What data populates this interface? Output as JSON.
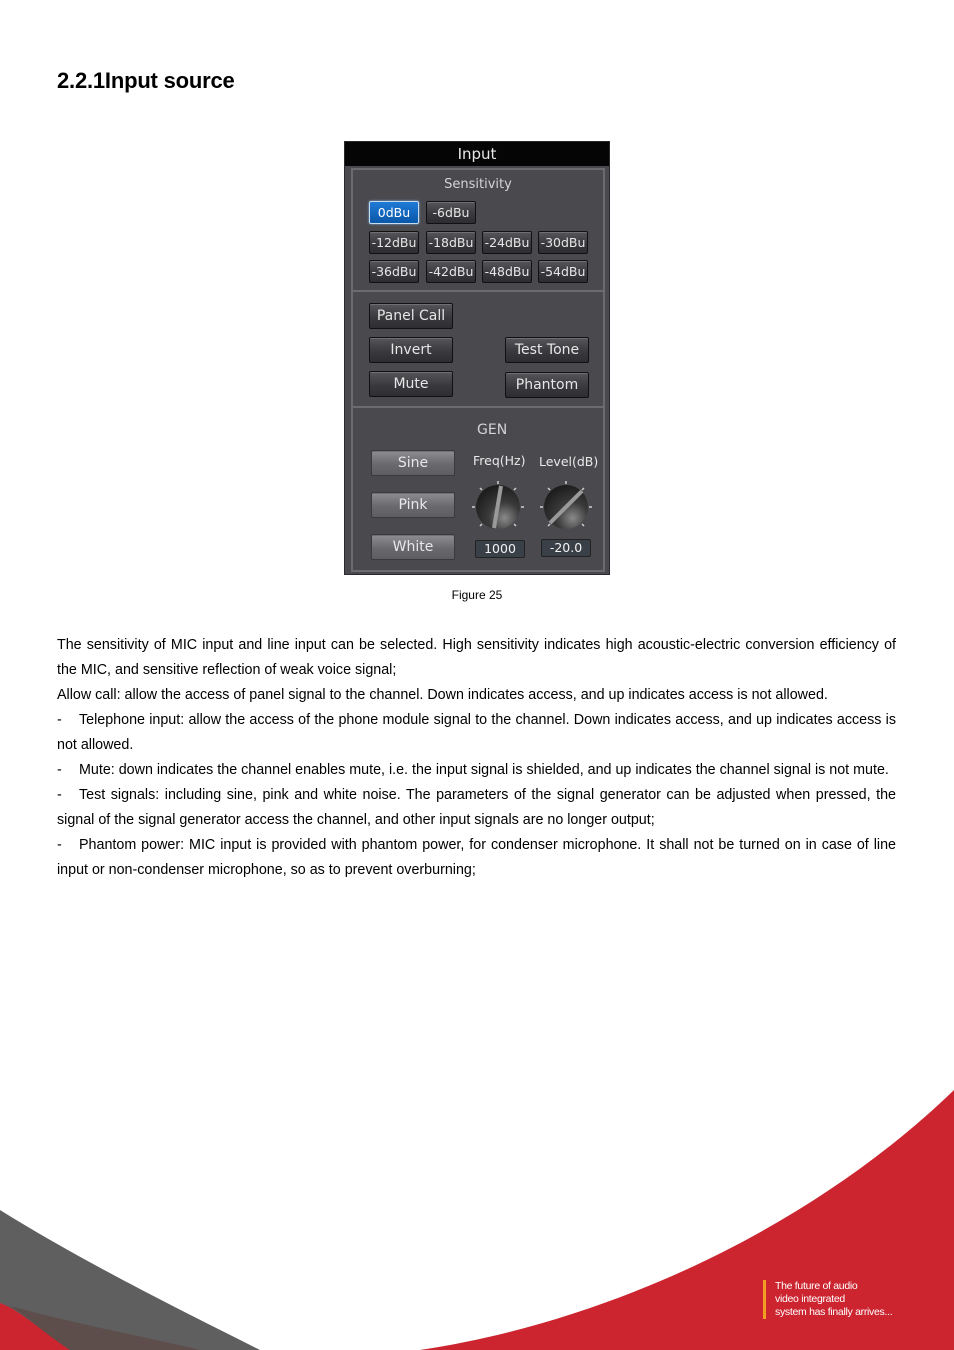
{
  "heading": "2.2.1Input source",
  "figure": {
    "window_title": "Input",
    "sensitivity": {
      "label": "Sensitivity",
      "selected": "0dBu",
      "options": [
        "0dBu",
        "-6dBu",
        "-12dBu",
        "-18dBu",
        "-24dBu",
        "-30dBu",
        "-36dBu",
        "-42dBu",
        "-48dBu",
        "-54dBu"
      ]
    },
    "controls": {
      "panel_call": "Panel Call",
      "invert": "Invert",
      "mute": "Mute",
      "test_tone": "Test Tone",
      "phantom": "Phantom"
    },
    "gen": {
      "label": "GEN",
      "sine": "Sine",
      "pink": "Pink",
      "white": "White",
      "freq_label": "Freq(Hz)",
      "level_label": "Level(dB)",
      "freq_value": "1000",
      "level_value": "-20.0"
    },
    "caption": "Figure 25"
  },
  "body": {
    "p1": "The sensitivity of MIC input and line input can be selected. High sensitivity indicates high acoustic-electric conversion efficiency of the MIC, and sensitive reflection of weak voice signal;",
    "p2": "Allow call: allow the access of panel signal to the channel. Down indicates access, and up indicates access is not allowed.",
    "bullets": [
      "Telephone input: allow the access of the phone module signal to the channel. Down indicates access, and up indicates access is not allowed.",
      "Mute: down indicates the channel enables mute, i.e. the input signal is shielded, and up indicates the channel signal is not mute.",
      "Test signals: including sine, pink and white noise. The parameters of the signal generator can be adjusted when pressed, the signal of the signal generator access the channel, and other input signals are no longer output;",
      "Phantom power: MIC input is provided with phantom power, for condenser microphone. It shall not be turned on in case of line input or non-condenser microphone, so as to prevent overburning;"
    ],
    "bullet_marker": "-"
  },
  "footer": {
    "tagline_lines": [
      "The future of audio",
      "video integrated",
      "system has finally arrives..."
    ],
    "colors": {
      "red": "#cc2530",
      "gray": "#5f5f5f",
      "accent": "#f0a020"
    }
  }
}
